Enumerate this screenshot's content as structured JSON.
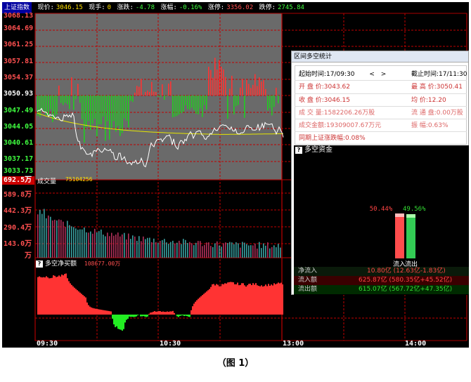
{
  "top_bar": {
    "index_name": "上证指数",
    "price_label": "现价:",
    "price_value": "3046.15",
    "lot_label": "现手:",
    "lot_value": "0",
    "change_label": "涨跌:",
    "change_value": "-4.78",
    "change_pct_label": "涨幅:",
    "change_pct_value": "-0.16%",
    "limit_up_label": "涨停:",
    "limit_up_value": "3356.02",
    "limit_down_label": "跌停:",
    "limit_down_value": "2745.84"
  },
  "price_axis": [
    "3068.13",
    "3064.69",
    "3061.25",
    "3057.81",
    "3054.37",
    "3050.93",
    "3047.49",
    "3044.05",
    "3040.61",
    "3037.17",
    "3033.73"
  ],
  "volume_panel": {
    "title": "成交量",
    "value": "75104256",
    "current_label": "692.5万",
    "axis": [
      "589.8万",
      "442.3万",
      "290.4万",
      "143.0万",
      "万"
    ]
  },
  "net_flow_panel": {
    "title": "多空净买额",
    "value": "108677.00万"
  },
  "time_axis": [
    "09:30",
    "10:30",
    "13:00",
    "14:00"
  ],
  "dialog": {
    "title": "区间多空统计",
    "start_label": "起始时间:",
    "start_value": "17/09:30",
    "end_label": "截止时间:",
    "end_value": "17/11:30",
    "open_label": "开 盘 价:",
    "open_value": "3043.62",
    "high_label": "最 高 价:",
    "high_value": "3050.41",
    "close_label": "收 盘 价:",
    "close_value": "3046.15",
    "avg_label": "均    价:",
    "avg_value": "12.20",
    "volume_label": "成 交 量:",
    "volume_value": "1582206.26万股",
    "float_label": "流 通 盘:",
    "float_value": "0.00万股",
    "amount_label": "成交金额:",
    "amount_value": "19309007.67万元",
    "turnover_label": "振    幅:",
    "turnover_value": "0.63%",
    "same_period_label": "同期上证涨跌幅:",
    "same_period_value": "0.08%"
  },
  "capital_panel": {
    "title": "多空资金",
    "inflow_pct": "50.44%",
    "outflow_pct": "49.56%",
    "inflow_label": "流入",
    "outflow_label": "流出",
    "net_inflow_label": "净流入",
    "net_inflow_value": "10.80亿 (12.63亿-1.83亿)",
    "inflow_amount_label": "流入额",
    "inflow_amount_value": "625.87亿 (580.35亿+45.52亿)",
    "outflow_amount_label": "流出额",
    "outflow_amount_value": "615.07亿 (567.72亿+47.35亿)"
  },
  "caption": "（图 1）",
  "colors": {
    "up": "#ff3333",
    "down": "#22cc22",
    "grid": "#c00000",
    "avg_line": "#e6e600",
    "price_line": "#ffffff",
    "dialog_text": "#c33333"
  }
}
